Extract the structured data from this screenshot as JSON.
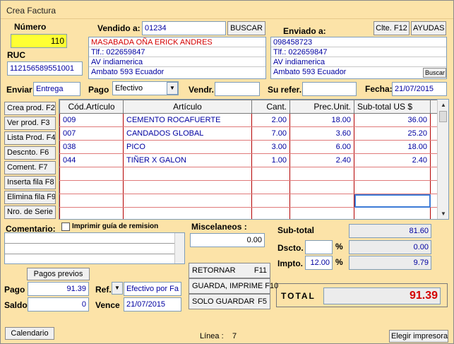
{
  "window": {
    "title": "Crea Factura"
  },
  "numero": {
    "label": "Número",
    "value": "110"
  },
  "ruc": {
    "label": "RUC",
    "value": "112156589551001"
  },
  "vendido": {
    "label": "Vendido a:",
    "code": "01234",
    "buscar": "BUSCAR",
    "lines": [
      "MASABADA OÑA ERICK ANDRES",
      "Tlf.: 022659847",
      "AV indiamerica",
      "Ambato  593 Ecuador"
    ]
  },
  "enviado": {
    "label": "Enviado a:",
    "clte_btn": "Clte. F12",
    "ayudas_btn": "AYUDAS",
    "lines": [
      "098458723",
      "Tlf.: 022659847",
      "AV indiamerica",
      "Ambato  593 Ecuador"
    ],
    "buscar_small": "Buscar"
  },
  "row2": {
    "enviar_label": "Enviar",
    "enviar_value": "Entrega",
    "pago_label": "Pago",
    "pago_value": "Efectivo",
    "vendr_label": "Vendr.",
    "vendr_value": "",
    "su_refer_label": "Su refer.",
    "su_refer_value": "",
    "fecha_label": "Fecha:",
    "fecha_value": "21/07/2015"
  },
  "sidebar": [
    "Crea prod. F2",
    "Ver prod.   F3",
    "Lista  Prod. F4",
    "Descnto.    F6",
    "Coment.     F7",
    "Inserta fila  F8",
    "Elimina fila  F9",
    "Nro. de Serie"
  ],
  "grid": {
    "headers": [
      "Cód.Artículo",
      "Artículo",
      "Cant.",
      "Prec.Unit.",
      "Sub-total  US $"
    ],
    "rows": [
      [
        "009",
        "CEMENTO ROCAFUERTE",
        "2.00",
        "18.00",
        "36.00"
      ],
      [
        "007",
        "CANDADOS GLOBAL",
        "7.00",
        "3.60",
        "25.20"
      ],
      [
        "038",
        "PICO",
        "3.00",
        "6.00",
        "18.00"
      ],
      [
        "044",
        "TIÑER X GALON",
        "1.00",
        "2.40",
        "2.40"
      ],
      [
        "",
        "",
        "",
        "",
        ""
      ],
      [
        "",
        "",
        "",
        "",
        ""
      ],
      [
        "",
        "",
        "",
        "",
        ""
      ],
      [
        "",
        "",
        "",
        "",
        ""
      ]
    ]
  },
  "comentario": {
    "label": "Comentario:",
    "imprimir_guia": "Imprimir guía de remision"
  },
  "misc": {
    "label": "Miscelaneos :",
    "value": "0.00"
  },
  "totals": {
    "subtotal_label": "Sub-total",
    "subtotal_value": "81.60",
    "dscto_label": "Dscto.",
    "dscto_pct": "",
    "dscto_value": "0.00",
    "impto_label": "Impto.",
    "impto_pct": "12.00",
    "impto_value": "9.79",
    "pct_symbol": "%",
    "total_label": "TOTAL",
    "total_value": "91.39"
  },
  "payments": {
    "pagos_previos": "Pagos previos",
    "pago_label": "Pago",
    "pago_value": "91.39",
    "saldo_label": "Saldo",
    "saldo_value": "0",
    "ref_label": "Ref.",
    "ref_value": "Efectivo por Fa",
    "vence_label": "Vence",
    "vence_value": "21/07/2015"
  },
  "actions": {
    "retornar": "RETORNAR",
    "retornar_key": "F11",
    "guardar_imprime": "GUARDA, IMPRIME F10",
    "solo_guardar": "SOLO GUARDAR",
    "solo_guardar_key": "F5"
  },
  "footer": {
    "calendario": "Calendario",
    "linea_label": "Línea :",
    "linea_value": "7",
    "elegir_impresora": "Elegir impresora"
  },
  "colors": {
    "background": "#fce3a8",
    "accent_red": "#d40000",
    "value_blue": "#0000a0",
    "numero_yellow": "#ffff33"
  },
  "icons": {
    "combo": "chevron-down-icon",
    "scroll_up": "scroll-up-icon",
    "scroll_down": "scroll-down-icon"
  }
}
